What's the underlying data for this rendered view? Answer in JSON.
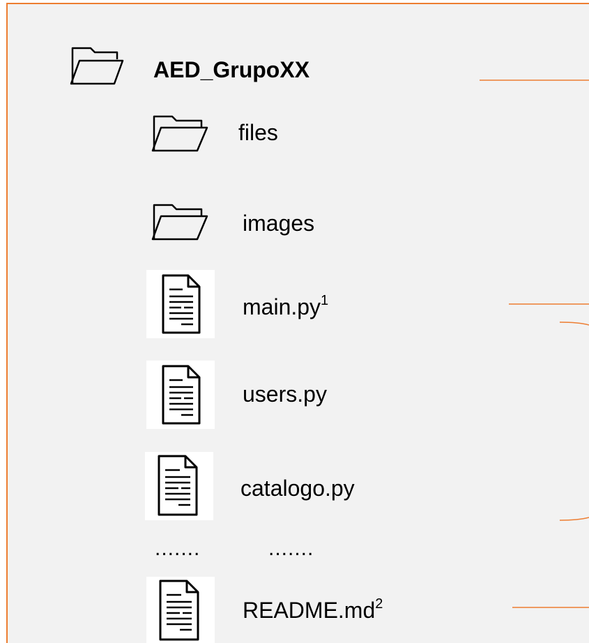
{
  "root": {
    "name": "AED_GrupoXX",
    "icon": "folder-icon"
  },
  "items": [
    {
      "name": "files",
      "icon": "folder-icon"
    },
    {
      "name": "images",
      "icon": "folder-icon"
    },
    {
      "name": "main.py",
      "note": "1",
      "icon": "document-icon"
    },
    {
      "name": "users.py",
      "icon": "document-icon"
    },
    {
      "name": "catalogo.py",
      "icon": "document-icon"
    },
    {
      "name": "README.md",
      "note": "2",
      "icon": "document-icon"
    }
  ],
  "ellipsis": {
    "left": ".......",
    "right": "......."
  },
  "colors": {
    "accent": "#ed7d31",
    "background": "#f2f2f2",
    "text": "#000000"
  }
}
